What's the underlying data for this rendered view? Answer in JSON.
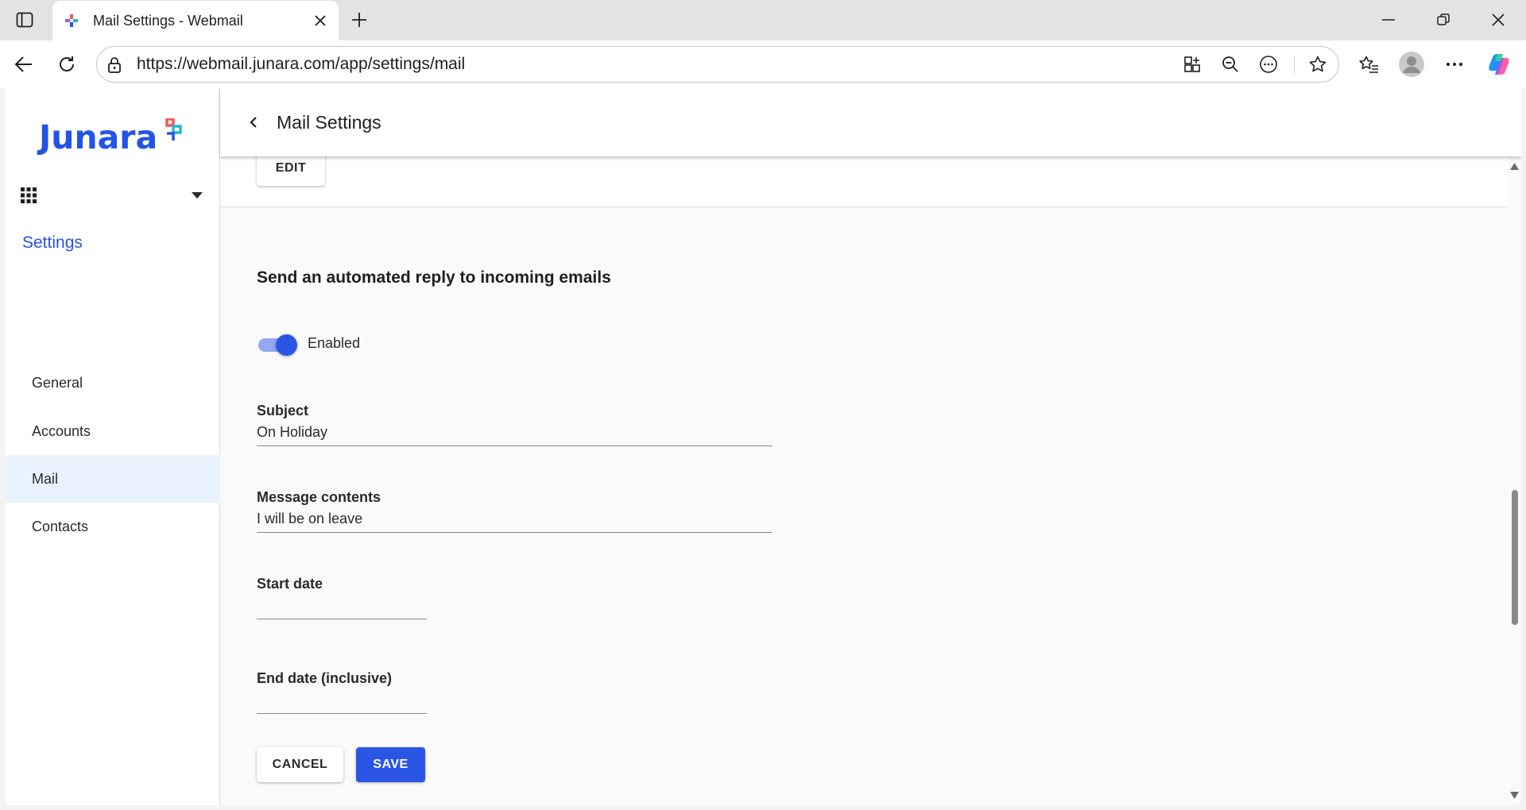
{
  "browser": {
    "tab_title": "Mail Settings - Webmail",
    "url": "https://webmail.junara.com/app/settings/mail"
  },
  "sidebar": {
    "logo_text": "Junara",
    "section_label": "Settings",
    "items": [
      {
        "label": "General"
      },
      {
        "label": "Accounts"
      },
      {
        "label": "Mail"
      },
      {
        "label": "Contacts"
      }
    ],
    "active_item": "Mail"
  },
  "header": {
    "title": "Mail Settings"
  },
  "top_card": {
    "edit_label": "EDIT"
  },
  "auto_reply": {
    "section_title": "Send an automated reply to incoming emails",
    "toggle_label": "Enabled",
    "toggle_on": true,
    "subject_label": "Subject",
    "subject_value": "On Holiday",
    "message_label": "Message contents",
    "message_value": "I will be on leave",
    "start_label": "Start date",
    "start_value": "",
    "end_label": "End date (inclusive)",
    "end_value": "",
    "cancel_label": "CANCEL",
    "save_label": "SAVE"
  },
  "icons": {
    "tab_actions": "sidebar-toggle-icon",
    "favicon": "junara-favicon-icon",
    "close": "close-icon",
    "new_tab": "plus-icon",
    "minimize": "minimize-icon",
    "restore": "restore-icon",
    "window_close": "close-icon",
    "back": "arrow-left-icon",
    "refresh": "refresh-icon",
    "lock": "lock-icon",
    "apps": "grid-apps-icon",
    "zoom": "zoom-out-icon",
    "more_page": "more-circle-icon",
    "favorite": "star-icon",
    "favorites": "favorites-list-icon",
    "profile": "avatar-icon",
    "menu": "more-horizontal-icon",
    "copilot": "copilot-icon"
  },
  "colors": {
    "brand": "#2454e6",
    "primary_button": "#2a55e5",
    "active_nav": "#e8f3fd"
  }
}
